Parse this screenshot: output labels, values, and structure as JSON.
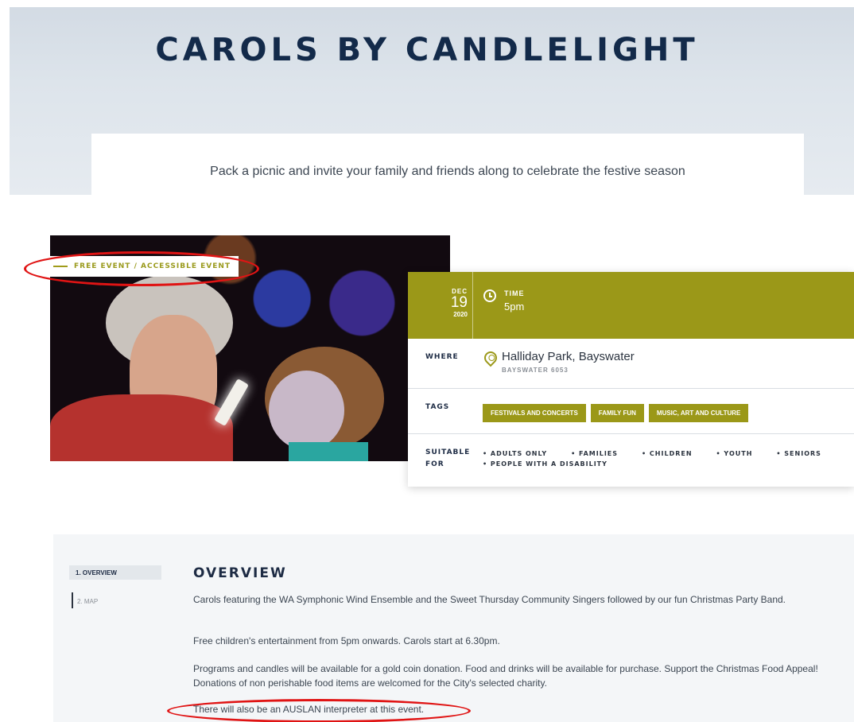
{
  "hero": {
    "title": "CAROLS BY CANDLELIGHT",
    "subtitle": "Pack a picnic and invite your family and friends along to celebrate the festive season"
  },
  "badge": {
    "label": "FREE EVENT / ACCESSIBLE EVENT"
  },
  "event": {
    "date": {
      "month": "DEC",
      "day": "19",
      "year": "2020"
    },
    "time": {
      "label": "TIME",
      "value": "5pm"
    },
    "where": {
      "label": "WHERE",
      "name": "Halliday Park, Bayswater",
      "suburb": "BAYSWATER 6053"
    },
    "tags": {
      "label": "TAGS",
      "items": [
        "FESTIVALS AND CONCERTS",
        "FAMILY FUN",
        "MUSIC, ART AND CULTURE"
      ]
    },
    "suitable": {
      "label_line1": "SUITABLE",
      "label_line2": "FOR",
      "items": [
        "• ADULTS ONLY",
        "• FAMILIES",
        "• CHILDREN",
        "• YOUTH",
        "• SENIORS",
        "• PEOPLE WITH A DISABILITY"
      ]
    }
  },
  "nav": {
    "items": [
      "1. OVERVIEW",
      "2. MAP"
    ]
  },
  "overview": {
    "heading": "OVERVIEW",
    "paragraphs": [
      "Carols featuring the WA Symphonic Wind Ensemble and the Sweet Thursday Community Singers followed by our fun Christmas Party Band.",
      "Free children's entertainment from 5pm onwards. Carols start at 6.30pm.",
      "Programs and candles will be available for a gold coin donation. Food and drinks will be available for purchase. Support the Christmas Food Appeal! Donations of non perishable food items are welcomed for the City's selected charity.",
      "There will also be an AUSLAN interpreter at this event."
    ]
  },
  "colors": {
    "accent": "#9b9818",
    "navy": "#132a4a",
    "annotation": "#e01414"
  }
}
